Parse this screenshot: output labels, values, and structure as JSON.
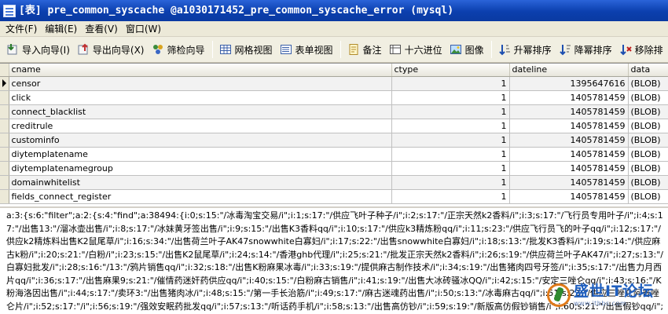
{
  "window": {
    "title": "[表] pre_common_syscache @a1030171452_pre_common_syscache_error (mysql)"
  },
  "menu": {
    "items": [
      "文件(F)",
      "编辑(E)",
      "查看(V)",
      "窗口(W)"
    ]
  },
  "toolbar": {
    "import_label": "导入向导(I)",
    "export_label": "导出向导(X)",
    "filter_label": "筛检向导",
    "grid_view_label": "网格视图",
    "form_view_label": "表单视图",
    "memo_label": "备注",
    "hex_label": "十六进位",
    "image_label": "图像",
    "sort_asc_label": "升幂排序",
    "sort_desc_label": "降幂排序",
    "remove_sort_label": "移除排"
  },
  "grid": {
    "columns": [
      "cname",
      "ctype",
      "dateline",
      "data"
    ],
    "rows": [
      {
        "cname": "censor",
        "ctype": "1",
        "dateline": "1395647616",
        "data": "(BLOB)"
      },
      {
        "cname": "click",
        "ctype": "1",
        "dateline": "1405781459",
        "data": "(BLOB)"
      },
      {
        "cname": "connect_blacklist",
        "ctype": "1",
        "dateline": "1405781459",
        "data": "(BLOB)"
      },
      {
        "cname": "creditrule",
        "ctype": "1",
        "dateline": "1405781459",
        "data": "(BLOB)"
      },
      {
        "cname": "custominfo",
        "ctype": "1",
        "dateline": "1405781459",
        "data": "(BLOB)"
      },
      {
        "cname": "diytemplatename",
        "ctype": "1",
        "dateline": "1405781459",
        "data": "(BLOB)"
      },
      {
        "cname": "diytemplatenamegroup",
        "ctype": "1",
        "dateline": "1405781459",
        "data": "(BLOB)"
      },
      {
        "cname": "domainwhitelist",
        "ctype": "1",
        "dateline": "1405781459",
        "data": "(BLOB)"
      },
      {
        "cname": "fields_connect_register",
        "ctype": "1",
        "dateline": "1405781459",
        "data": "(BLOB)"
      }
    ]
  },
  "memo": {
    "text": "a:3:{s:6:\"filter\";a:2:{s:4:\"find\";a:38494:{i:0;s:15:\"/冰毒淘宝交易/i\";i:1;s:17:\"/供应飞叶子种子/i\";i:2;s:17:\"/正宗天然k2香料/i\";i:3;s:17:\"/飞行员专用叶子/i\";i:4;s:17:\"/出售13:\"/溜冰壶出售/i\";i:8;s:17:\"/冰妹黄牙签出售/i\";i:9;s:15:\"/出售K3香料qq/i\";i:10;s:17:\"/供应k3精炼粉qq/i\";i:11;s:23:\"/供应飞行员飞的叶子qq/i\";i:12;s:17:\"/供应k2精炼料出售K2鼠尾草/i\";i:16;s:34:\"/出售荷兰叶子AK47snowwhite白寡妇/i\";i:17;s:22:\"/出售snowwhite白寡妇/i\";i:18;s:13:\"/批发K3香料/i\";i:19;s:14:\"/供应麻古k粉/i\";i:20;s:21:\"/白粉/i\";i:23;s:15:\"/出售K2鼠尾草/i\";i:24;s:14:\"/香港ghb代理/i\";i:25;s:21:\"/批发正宗天然k2香料/i\";i:26;s:19:\"/供应荷兰叶子AK47/i\";i:27;s:13:\"/白寡妇批发/i\";i:28;s:16:\"/13:\"/鸦片销售qq/i\";i:32;s:18:\"/出售K粉麻果冰毒/i\";i:33;s:19:\"/提供麻古制作技术/i\";i:34;s:19:\"/出售猪肉四号牙签/i\";i:35;s:17:\"/出售力月西片qq/i\";i:36;s:17:\"/出售麻果9;s:21:\"/催情药迷奸药供应qq/i\";i:40;s:15:\"/白粉麻古销售/i\";i:41;s:19:\"/出售大冰砖骚冰QQ/i\";i:42;s:15:\"/安定三唑仑qq/i\";i:43;s:16:\"/K粉海洛因出售/i\";i:44;s:17:\"/卖环3:\"/出售猪肉冰/i\";i:48;s:15:\"/第一手长治筋/i\";i:49;s:17:\"/麻古迷魂药出售/i\";i:50;s:13:\"/冰毒麻古qq/i\";i:51;s:23:\"/供应三唑仑阿普唑仑片/i\";i:52;s:17:\"/i\";i:56;s:19:\"/强效安眠药批发qq/i\";i:57;s:13:\"/听话药手机/i\";i:58;s:13:\"/出售高仿钞/i\";i:59;s:19:\"/新版高仿假钞销售/i\";i:60;s:21:\"/出售假钞qq/i\";i:67;s:17:\"/精品蝴蝶刀供应/i\";i:65;s:19:\"/正品蝴蝶甩刀专卖/i\";i:66;s:17:\"/专卖野外求生刀/i\";i:67;s:13:\"/格斗刀专卖/i\";i:68;s:23:\"/最新银行卡复制器出售/i\";i:69;s:17:\"/真实身份证代办/i\";i:70;s:19:\"/高仿回收银行卡/i\";i:71;s:17:\"/QQ在线出售号码/i\";i:72;s:15:\"/出售监听设备/i\";i:73;s:19:\"/出售高仿精品手机/i\""
  },
  "watermark": {
    "brand_text": "盛世IT论坛",
    "url_text": "www.itbbs.com"
  }
}
